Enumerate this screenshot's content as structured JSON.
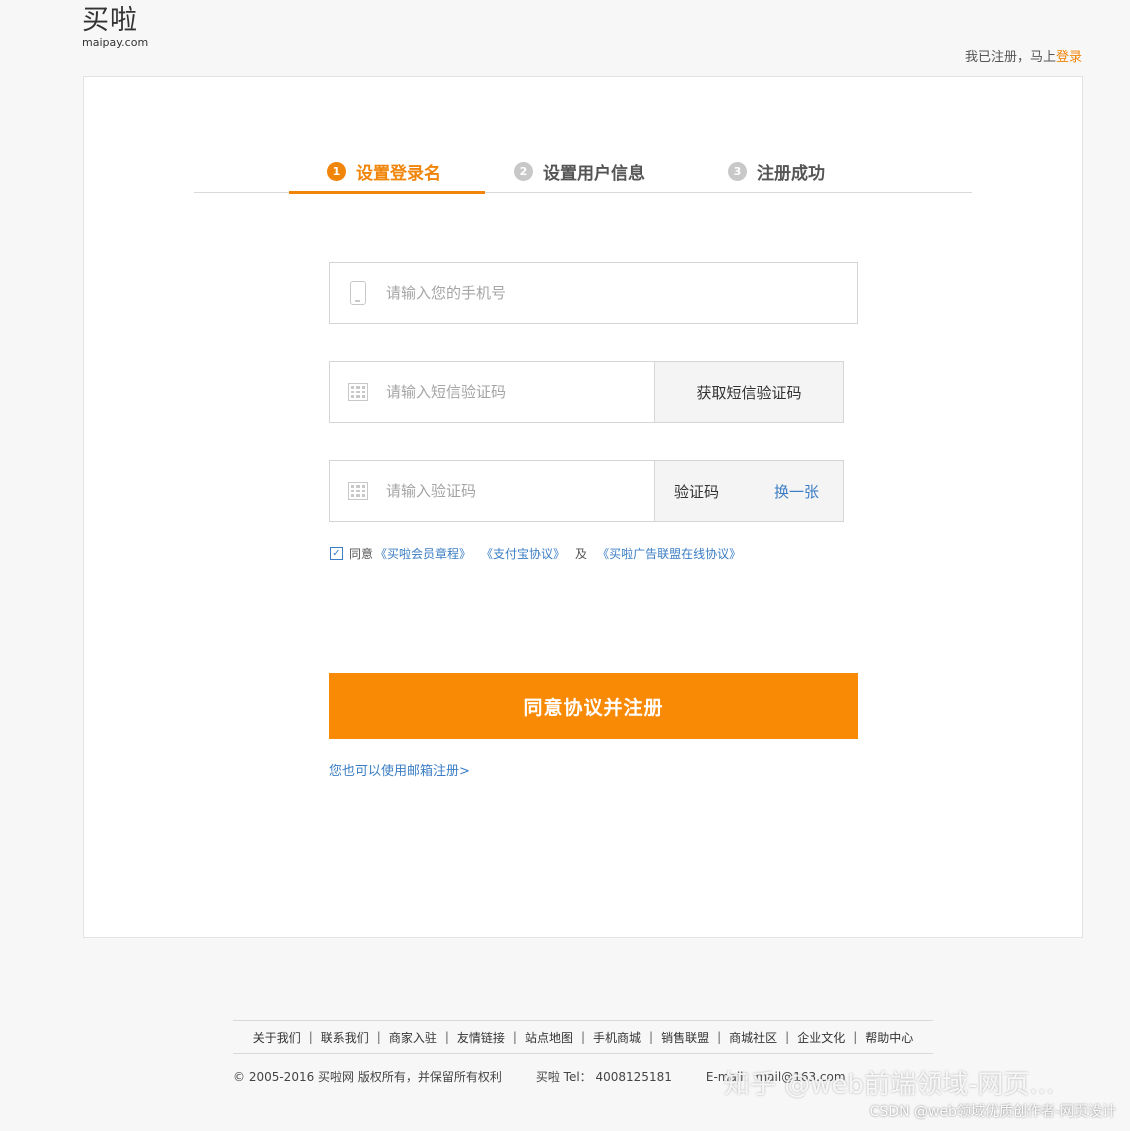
{
  "logo": {
    "cn": "买啦",
    "en": "maipay.com"
  },
  "top": {
    "prefix": "我已注册，马上",
    "login": "登录"
  },
  "steps": [
    {
      "num": "1",
      "label": "设置登录名"
    },
    {
      "num": "2",
      "label": "设置用户信息"
    },
    {
      "num": "3",
      "label": "注册成功"
    }
  ],
  "form": {
    "phone_placeholder": "请输入您的手机号",
    "sms_placeholder": "请输入短信验证码",
    "sms_button": "获取短信验证码",
    "captcha_placeholder": "请输入验证码",
    "captcha_label": "验证码",
    "captcha_refresh": "换一张",
    "agree_text": "同意",
    "agreement1": "《买啦会员章程》",
    "agreement2": "《支付宝协议》",
    "and": "及",
    "agreement3": "《买啦广告联盟在线协议》",
    "submit": "同意协议并注册",
    "email_link": "您也可以使用邮箱注册>"
  },
  "footer": {
    "links": [
      "关于我们",
      "联系我们",
      "商家入驻",
      "友情链接",
      "站点地图",
      "手机商城",
      "销售联盟",
      "商城社区",
      "企业文化",
      "帮助中心"
    ],
    "copyright": "©  2005-2016 买啦网 版权所有，并保留所有权利",
    "tel": "买啦 Tel： 4008125181",
    "email": "E-mail：mail@163.com"
  },
  "watermark": {
    "zhihu": "知乎 @web前端领域-网页...",
    "csdn": "CSDN @web领域优质创作者-网页设计"
  }
}
